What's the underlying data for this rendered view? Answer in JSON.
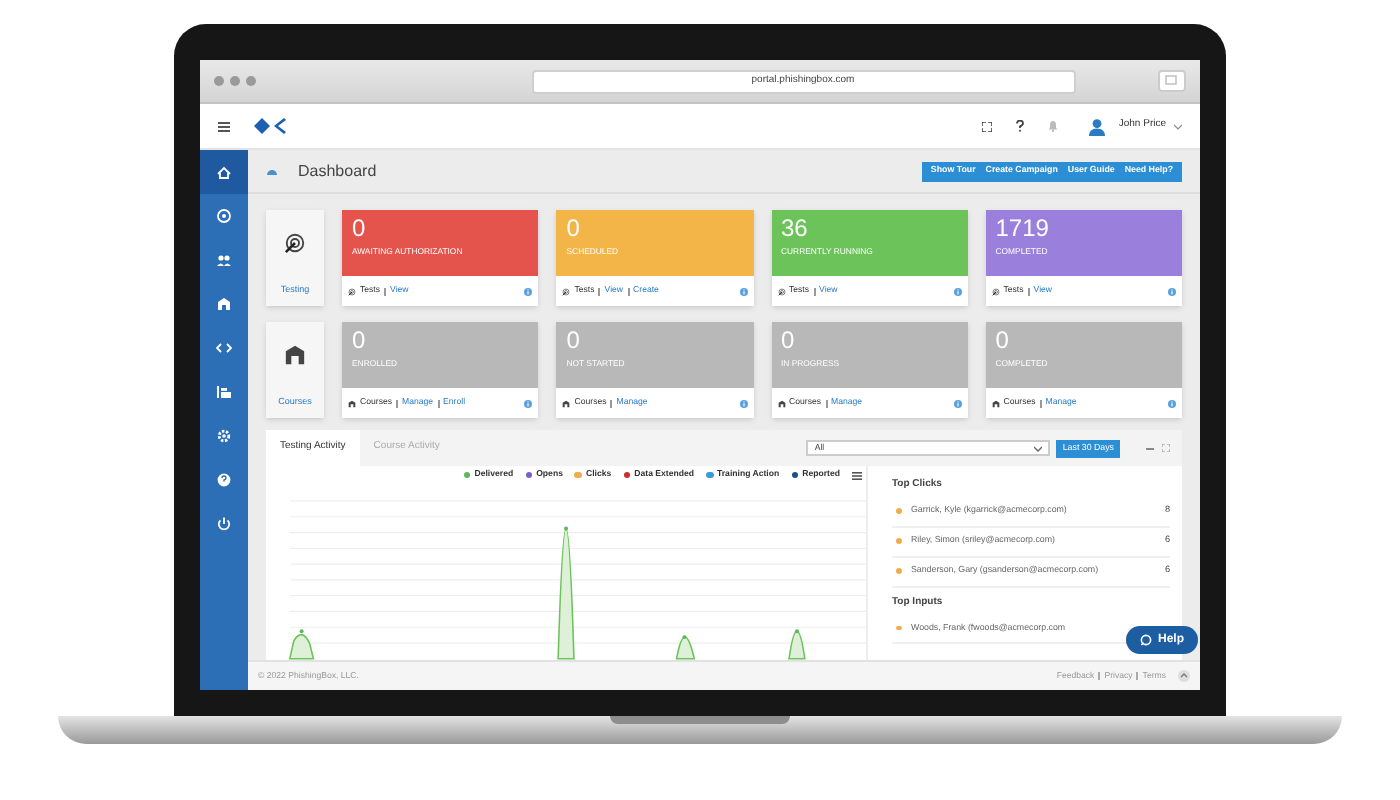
{
  "browser": {
    "url": "portal.phishingbox.com"
  },
  "header": {
    "user": "John Price"
  },
  "sidebar": {
    "items": [
      {
        "selected": true
      },
      {
        "selected": false
      },
      {
        "selected": false
      },
      {
        "selected": false
      },
      {
        "selected": false
      },
      {
        "selected": false
      },
      {
        "selected": false
      },
      {
        "selected": false
      },
      {
        "selected": false
      }
    ]
  },
  "page": {
    "title": "Dashboard"
  },
  "actions": [
    "Show Tour",
    "Create Campaign",
    "User Guide",
    "Need Help?"
  ],
  "sections": [
    {
      "label": "Testing",
      "stats": [
        {
          "value": "0",
          "label": "AWAITING AUTHORIZATION",
          "color": "#e5544c",
          "footer_label": "Tests",
          "links": [
            "View"
          ]
        },
        {
          "value": "0",
          "label": "SCHEDULED",
          "color": "#f3b548",
          "footer_label": "Tests",
          "links": [
            "View",
            "Create"
          ]
        },
        {
          "value": "36",
          "label": "CURRENTLY RUNNING",
          "color": "#6cc35a",
          "footer_label": "Tests",
          "links": [
            "View"
          ]
        },
        {
          "value": "1719",
          "label": "COMPLETED",
          "color": "#9b7fdc",
          "footer_label": "Tests",
          "links": [
            "View"
          ]
        }
      ]
    },
    {
      "label": "Courses",
      "stats": [
        {
          "value": "0",
          "label": "ENROLLED",
          "color": "#b8b8b8",
          "footer_label": "Courses",
          "links": [
            "Manage",
            "Enroll"
          ]
        },
        {
          "value": "0",
          "label": "NOT STARTED",
          "color": "#b8b8b8",
          "footer_label": "Courses",
          "links": [
            "Manage"
          ]
        },
        {
          "value": "0",
          "label": "IN PROGRESS",
          "color": "#b8b8b8",
          "footer_label": "Courses",
          "links": [
            "Manage"
          ]
        },
        {
          "value": "0",
          "label": "COMPLETED",
          "color": "#b8b8b8",
          "footer_label": "Courses",
          "links": [
            "Manage"
          ]
        }
      ]
    }
  ],
  "tabs": [
    {
      "label": "Testing Activity",
      "selected": true
    },
    {
      "label": "Course Activity",
      "selected": false
    }
  ],
  "filter": {
    "value": "All"
  },
  "range": {
    "label": "Last 30 Days"
  },
  "legend": [
    {
      "label": "Delivered",
      "color": "#5cb85c"
    },
    {
      "label": "Opens",
      "color": "#7b5fc7"
    },
    {
      "label": "Clicks",
      "color": "#f0ad4e"
    },
    {
      "label": "Data Extended",
      "color": "#c9302c"
    },
    {
      "label": "Training Action",
      "color": "#3a9ad9"
    },
    {
      "label": "Reported",
      "color": "#1f4e8c"
    }
  ],
  "top_clicks": {
    "title": "Top Clicks",
    "rows": [
      {
        "name": "Garrick, Kyle (kgarrick@acmecorp.com)",
        "count": "8"
      },
      {
        "name": "Riley, Simon (sriley@acmecorp.com)",
        "count": "6"
      },
      {
        "name": "Sanderson, Gary (gsanderson@acmecorp.com)",
        "count": "6"
      }
    ]
  },
  "top_inputs": {
    "title": "Top Inputs",
    "rows": [
      {
        "name": "Woods, Frank (fwoods@acmecorp.com"
      }
    ]
  },
  "help": {
    "label": "Help"
  },
  "footer": {
    "copyright": "© 2022 PhishingBox, LLC.",
    "links": [
      "Feedback",
      "Privacy",
      "Terms"
    ]
  }
}
